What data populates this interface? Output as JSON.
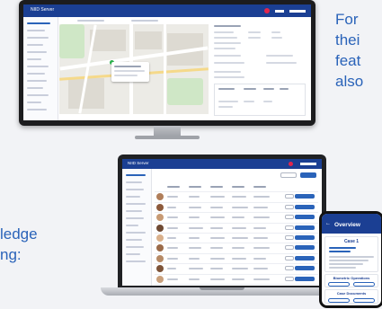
{
  "background_text": {
    "right_top": [
      "For",
      "thei",
      "feat",
      "also"
    ],
    "left_bottom": [
      "ledge",
      "ng:"
    ]
  },
  "monitor": {
    "app_title": "NIID Server",
    "colors": {
      "brand": "#1b3f93",
      "accent": "#2a63b9"
    }
  },
  "laptop": {
    "app_title": "NIID Server"
  },
  "phone": {
    "header_title": "Overview",
    "card_title": "Case 1",
    "section_biometric": "Biometric Operations",
    "section_documents": "Case Documents"
  }
}
